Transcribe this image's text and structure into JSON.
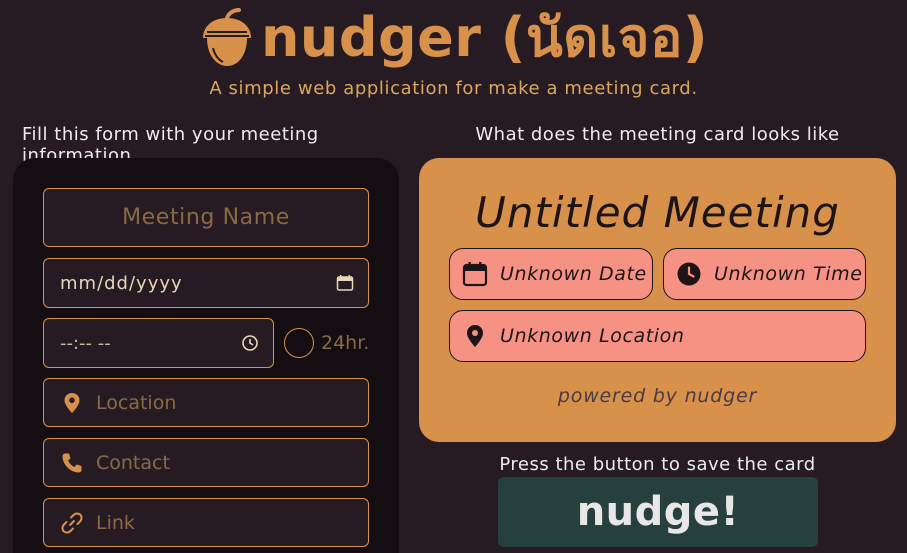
{
  "header": {
    "title": "nudger (นัดเจอ)",
    "subtitle": "A simple web application for make a meeting card.",
    "logo_icon": "acorn-icon"
  },
  "form": {
    "heading": "Fill this form with your meeting information",
    "meeting_name_placeholder": "Meeting Name",
    "date_value": "mm/dd/yyyy",
    "time_value": "--:-- --",
    "toggle_24hr_label": "24hr.",
    "location_placeholder": "Location",
    "contact_placeholder": "Contact",
    "link_placeholder": "Link"
  },
  "preview": {
    "heading": "What does the meeting card looks like",
    "card_title": "Untitled Meeting",
    "date_text": "Unknown Date",
    "time_text": "Unknown Time",
    "location_text": "Unknown Location",
    "powered_by": "powered by nudger"
  },
  "actions": {
    "hint": "Press the button to save the card",
    "nudge_label": "nudge!"
  },
  "colors": {
    "background": "#261b22",
    "accent": "#d8914a",
    "card": "#d8914a",
    "pill": "#f59283",
    "button": "#26403e"
  }
}
